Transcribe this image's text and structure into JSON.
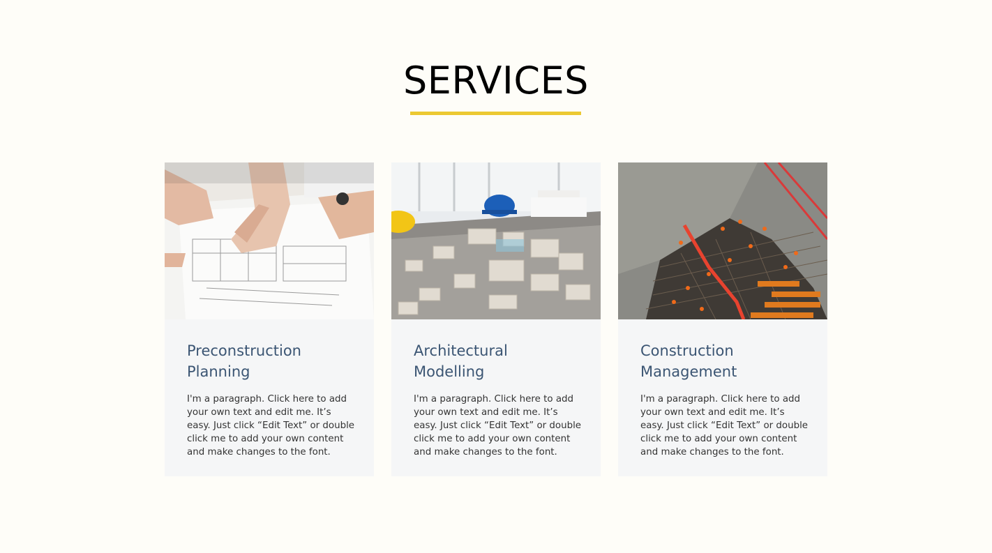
{
  "section": {
    "title": "SERVICES",
    "accent_color": "#ecc932"
  },
  "services": [
    {
      "title": "Preconstruction Planning",
      "body": "I'm a paragraph. Click here to add your own text and edit me. It’s easy. Just click “Edit Text” or double click me to add your own content and make changes to the font.",
      "image_icon": "blueprint-photo"
    },
    {
      "title": "Architectural Modelling",
      "body": "I'm a paragraph. Click here to add your own text and edit me. It’s easy. Just click “Edit Text” or double click me to add your own content and make changes to the font.",
      "image_icon": "architecture-model-photo"
    },
    {
      "title": "Construction Management",
      "body": "I'm a paragraph. Click here to add your own text and edit me. It’s easy. Just click “Edit Text” or double click me to add your own content and make changes to the font.",
      "image_icon": "construction-site-photo"
    }
  ],
  "colors": {
    "background": "#fefdf8",
    "card_background": "#f5f6f7",
    "card_title": "#3b5573"
  }
}
